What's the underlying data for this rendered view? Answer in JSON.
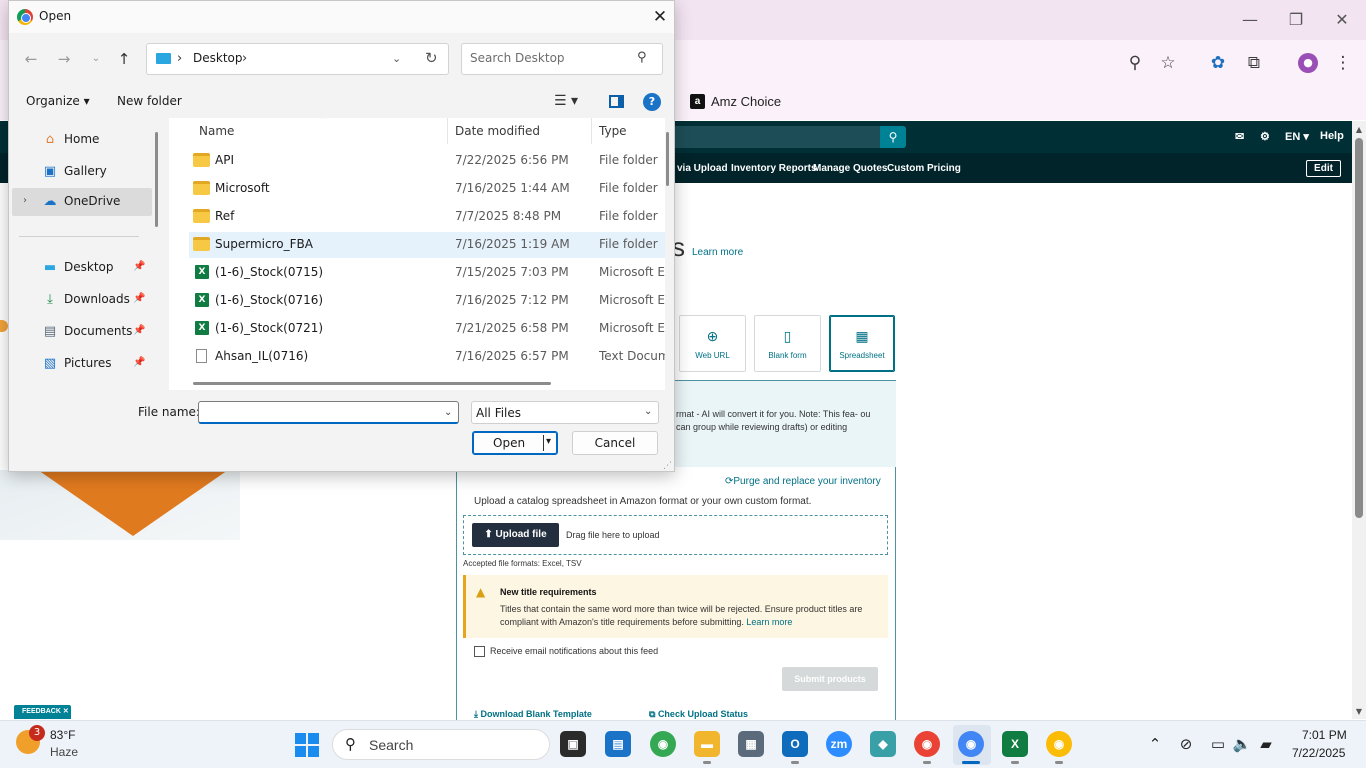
{
  "browser": {
    "bookmark_label": "Amz Choice",
    "bookmark_logo": "a",
    "icons": [
      "minimize-icon",
      "restore-icon",
      "close-icon",
      "zoom-icon",
      "star-icon",
      "extension-icon",
      "puzzle-icon",
      "profile-icon",
      "menu-icon"
    ]
  },
  "amazon": {
    "nav1": {
      "lang": "EN ▾",
      "help": "Help"
    },
    "nav2": [
      "via Upload",
      "Inventory Reports",
      "Manage Quotes",
      "Custom Pricing"
    ],
    "edit_label": "Edit",
    "heading_fragment": "s",
    "learn_more": "Learn more",
    "methods": [
      {
        "label": "Web URL",
        "icon": "globe-icon"
      },
      {
        "label": "Blank form",
        "icon": "document-icon"
      },
      {
        "label": "Spreadsheet",
        "icon": "spreadsheet-icon"
      }
    ],
    "info_text": "rmat - AI will convert it for you. Note: This fea- ou can group while reviewing drafts) or editing",
    "purge_link": "Purge and replace your inventory",
    "upload_desc": "Upload a catalog spreadsheet in Amazon format or your own custom format.",
    "upload_button": "Upload file",
    "drag_text": "Drag file here to upload",
    "formats_text": "Accepted file formats: Excel, TSV",
    "warning_title": "New title requirements",
    "warning_text": "Titles that contain the same word more than twice will be rejected. Ensure product titles are compliant with Amazon's title requirements before submitting.",
    "warning_link": "Learn more",
    "email_checkbox_label": "Receive email notifications about this feed",
    "submit_button": "Submit products",
    "download_template": "Download Blank Template",
    "check_status": "Check Upload Status",
    "feedback": "FEEDBACK ✕",
    "colors": {
      "nav_dark": "#002f36",
      "link": "#007185",
      "accent_orange": "#e07a1f"
    }
  },
  "dialog": {
    "title": "Open",
    "address": {
      "location": "Desktop"
    },
    "search": {
      "placeholder": "Search Desktop"
    },
    "toolbar": {
      "organize": "Organize ▾",
      "new_folder": "New folder",
      "help": "?"
    },
    "nav_items": [
      {
        "label": "Home",
        "icon": "home-icon",
        "pinned": false
      },
      {
        "label": "Gallery",
        "icon": "gallery-icon",
        "pinned": false
      },
      {
        "label": "OneDrive",
        "icon": "cloud-icon",
        "pinned": false
      },
      {
        "label": "Desktop",
        "icon": "desktop-icon",
        "pinned": true
      },
      {
        "label": "Downloads",
        "icon": "download-icon",
        "pinned": true
      },
      {
        "label": "Documents",
        "icon": "documents-icon",
        "pinned": true
      },
      {
        "label": "Pictures",
        "icon": "pictures-icon",
        "pinned": true
      }
    ],
    "columns": [
      "Name",
      "Date modified",
      "Type"
    ],
    "files": [
      {
        "name": "API",
        "date": "7/22/2025 6:56 PM",
        "type": "File folder",
        "kind": "folder"
      },
      {
        "name": "Microsoft",
        "date": "7/16/2025 1:44 AM",
        "type": "File folder",
        "kind": "folder"
      },
      {
        "name": "Ref",
        "date": "7/7/2025 8:48 PM",
        "type": "File folder",
        "kind": "folder"
      },
      {
        "name": "Supermicro_FBA",
        "date": "7/16/2025 1:19 AM",
        "type": "File folder",
        "kind": "folder"
      },
      {
        "name": "(1-6)_Stock(0715)",
        "date": "7/15/2025 7:03 PM",
        "type": "Microsoft Exc",
        "kind": "excel"
      },
      {
        "name": "(1-6)_Stock(0716)",
        "date": "7/16/2025 7:12 PM",
        "type": "Microsoft Exc",
        "kind": "excel"
      },
      {
        "name": "(1-6)_Stock(0721)",
        "date": "7/21/2025 6:58 PM",
        "type": "Microsoft Exc",
        "kind": "excel"
      },
      {
        "name": "Ahsan_IL(0716)",
        "date": "7/16/2025 6:57 PM",
        "type": "Text Docume",
        "kind": "text"
      }
    ],
    "file_name_label": "File name:",
    "file_name_value": "",
    "file_type": "All Files",
    "open_button": "Open",
    "cancel_button": "Cancel"
  },
  "taskbar": {
    "weather_temp": "83°F",
    "weather_desc": "Haze",
    "weather_badge": "3",
    "search_label": "Search",
    "apps": [
      {
        "name": "file-explorer-app",
        "color": "#2b2b2b",
        "glyph": "▣"
      },
      {
        "name": "store-app",
        "color": "#1a73c7",
        "glyph": "▤"
      },
      {
        "name": "chrome-app",
        "color": "#34a853",
        "glyph": "◉"
      },
      {
        "name": "folder-app",
        "color": "#f2b52e",
        "glyph": "▬"
      },
      {
        "name": "calculator-app",
        "color": "#5b6b7b",
        "glyph": "▦"
      },
      {
        "name": "outlook-app",
        "color": "#0f6cbd",
        "glyph": "O"
      },
      {
        "name": "zoom-app",
        "color": "#2d8cff",
        "glyph": "zm"
      },
      {
        "name": "app-diamond",
        "color": "#3aa0a8",
        "glyph": "◆"
      },
      {
        "name": "chrome-profile-1-app",
        "color": "#ea4335",
        "glyph": "◉"
      },
      {
        "name": "chrome-profile-2-app",
        "color": "#4285f4",
        "glyph": "◉"
      },
      {
        "name": "excel-app",
        "color": "#107c41",
        "glyph": "X"
      },
      {
        "name": "chrome-profile-3-app",
        "color": "#fbbc05",
        "glyph": "◉"
      }
    ],
    "time": "7:01 PM",
    "date": "7/22/2025"
  }
}
